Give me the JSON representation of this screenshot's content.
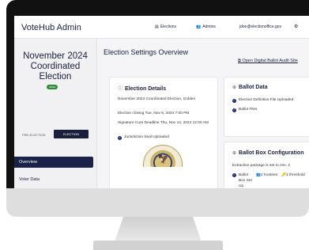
{
  "header": {
    "brand": "VoteHub Admin",
    "nav": {
      "elections": "Elections",
      "admins": "Admins",
      "user_email": "jdoe@electionoffice.gov"
    }
  },
  "sidebar": {
    "election_title": "November 2024 Coordinated Election",
    "status_badge": "OPEN",
    "tabs": {
      "pre_election": "PRE-ELECTION",
      "election": "ELECTION"
    },
    "menu": {
      "overview": "Overview",
      "voter_data": "Voter Data"
    }
  },
  "main": {
    "page_title": "Election Settings Overview",
    "audit_link": "Open Digital Ballot Audit Site",
    "election_details": {
      "title": "Election Details",
      "name": "November 2024 Coordinated Election, Golden",
      "closing": "Election closing Tue, Nov 5, 2024 7:00 PM",
      "cure_deadline": "Signature Cure Deadline Thu, Nov 14, 2024 12:00 AM",
      "seal_status": "Jurisdiction Seal Uploaded"
    },
    "ballot_data": {
      "title": "Ballot Data",
      "items": [
        "Election Definition File Uploaded",
        "Ballot Files"
      ]
    },
    "ballot_box": {
      "title": "Ballot Box Configuration",
      "description": "Extraction package is set to min. 2",
      "setup_label": "Ballot Box Set Up",
      "trustees": "2 trustees",
      "threshold": "1 threshold"
    }
  },
  "colors": {
    "navy": "#1a1f3c",
    "open_badge": "#2e8b3a",
    "active_menu": "#1a2347"
  },
  "icons": {
    "elections": "ballot-box-icon",
    "admins": "users-icon",
    "settings": "gear-icon",
    "check": "check-circle-icon",
    "info": "info-icon",
    "seal": "jurisdiction-seal-image"
  }
}
